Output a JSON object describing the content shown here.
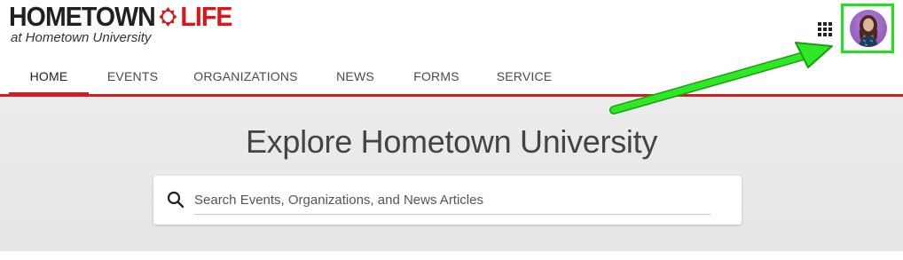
{
  "logo": {
    "word1": "HOMETOWN",
    "word2": "LIFE",
    "subtitle": "at Hometown University",
    "mark_icon": "hometown-life-mark-icon"
  },
  "header": {
    "apps_icon": "apps-grid-icon",
    "avatar_icon": "user-avatar"
  },
  "nav": {
    "items": [
      {
        "label": "HOME",
        "active": true
      },
      {
        "label": "EVENTS",
        "active": false
      },
      {
        "label": "ORGANIZATIONS",
        "active": false
      },
      {
        "label": "NEWS",
        "active": false
      },
      {
        "label": "FORMS",
        "active": false
      },
      {
        "label": "SERVICE",
        "active": false
      }
    ]
  },
  "hero": {
    "title": "Explore Hometown University",
    "search_placeholder": "Search Events, Organizations, and News Articles",
    "search_value": ""
  },
  "colors": {
    "brand_red": "#cf1f25",
    "annotation_green": "#22e01a",
    "hero_bg": "#e8e8e8"
  }
}
